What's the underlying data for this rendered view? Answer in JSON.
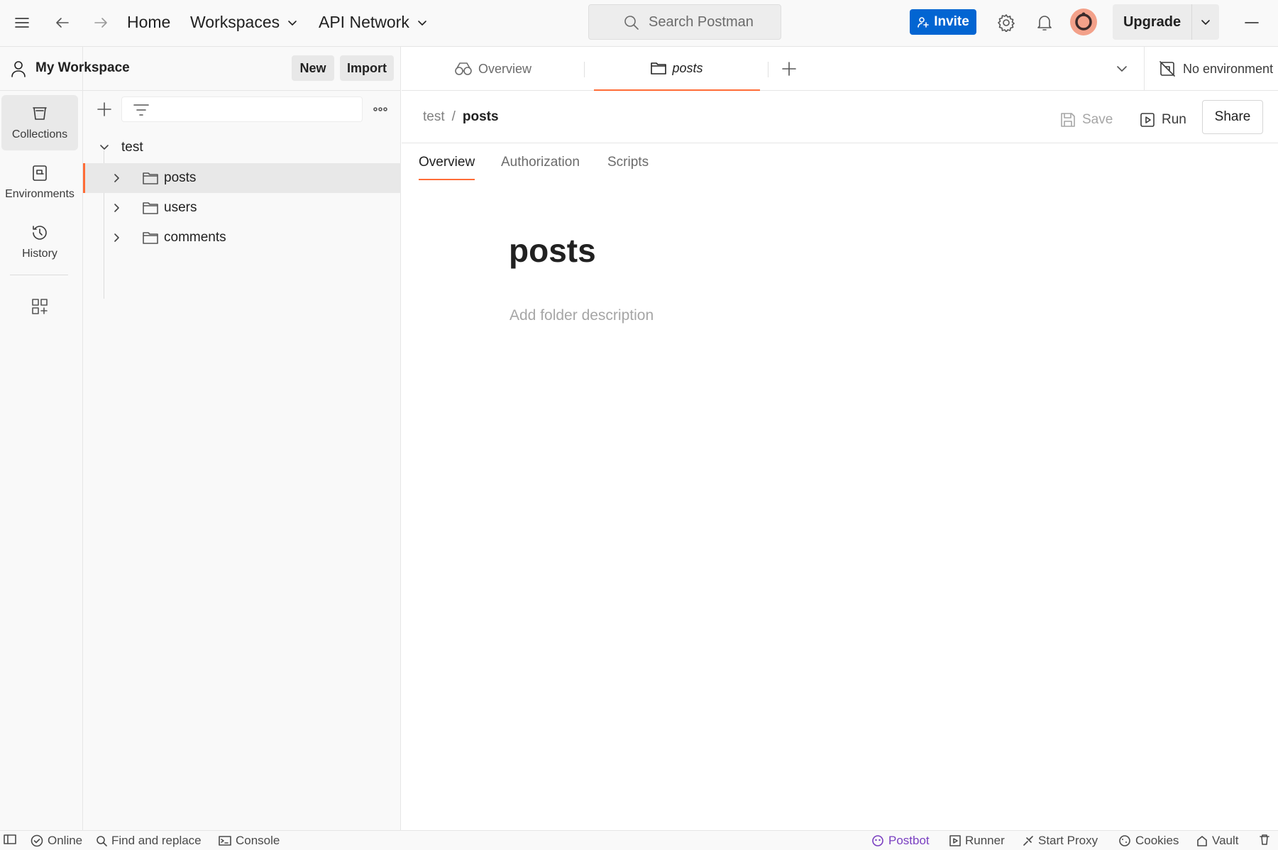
{
  "topbar": {
    "home": "Home",
    "workspaces": "Workspaces",
    "api_network": "API Network",
    "search_placeholder": "Search Postman",
    "invite": "Invite",
    "upgrade": "Upgrade"
  },
  "rail": {
    "items": [
      {
        "label": "Collections",
        "icon": "collections-icon",
        "active": true
      },
      {
        "label": "Environments",
        "icon": "environments-icon"
      },
      {
        "label": "History",
        "icon": "history-icon"
      }
    ]
  },
  "sidebar": {
    "workspace_title": "My Workspace",
    "new_label": "New",
    "import_label": "Import",
    "collection": "test",
    "folders": [
      "posts",
      "users",
      "comments"
    ],
    "selected_folder": "posts"
  },
  "tabs": {
    "overview": "Overview",
    "posts": "posts",
    "environment": "No environment"
  },
  "main": {
    "breadcrumb_parent": "test",
    "breadcrumb_sep": "/",
    "breadcrumb_current": "posts",
    "save": "Save",
    "run": "Run",
    "share": "Share",
    "subtabs": [
      "Overview",
      "Authorization",
      "Scripts"
    ],
    "folder_title": "posts",
    "folder_description_placeholder": "Add folder description"
  },
  "statusbar": {
    "online": "Online",
    "find_replace": "Find and replace",
    "console": "Console",
    "postbot": "Postbot",
    "runner": "Runner",
    "start_proxy": "Start Proxy",
    "cookies": "Cookies",
    "vault": "Vault"
  },
  "colors": {
    "accent": "#ff6c37",
    "invite_blue": "#0265d2",
    "postbot_purple": "#7a3fc1"
  }
}
